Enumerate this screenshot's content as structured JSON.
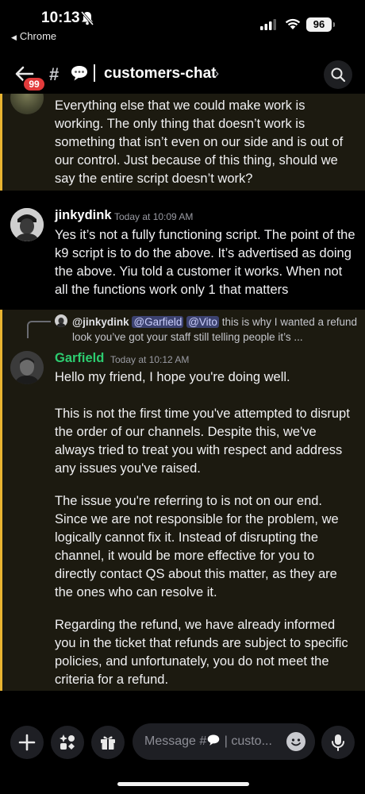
{
  "status_bar": {
    "time": "10:13",
    "back_app": "Chrome",
    "battery": "96"
  },
  "header": {
    "badge": "99",
    "hash": "#",
    "channel": "customers-chat",
    "chevron": "›"
  },
  "messages": [
    {
      "text": "Everything else that we could make work is working. The only thing that doesn’t work is something that isn’t even on our side and is out of our control. Just because of this thing, should we say the entire script doesn’t work?"
    },
    {
      "author": "jinkydink",
      "timestamp": "Today at 10:09 AM",
      "text": "Yes it’s not a fully functioning script. The point of the k9 script is to do the above. It’s advertised as doing the above. Yiu told a customer it works. When not all the functions work only 1 that matters"
    },
    {
      "reply": {
        "author": "@jinkydink",
        "mention1": "@Garfield",
        "mention2": "@Vito",
        "text": " this is why I wanted a refund look you’ve got your staff still telling people it’s ..."
      },
      "author": "Garfield",
      "timestamp": "Today at 10:12 AM",
      "paragraphs": [
        "Hello my friend, I hope you're doing well.",
        "This is not the first time you've attempted to disrupt the order of our channels. Despite this, we've always tried to treat you with respect and address any issues you've raised.",
        "The issue you're referring to is not on our end. Since we are not responsible for the problem, we logically cannot fix it. Instead of disrupting the channel, it would be more effective for you to directly contact QS about this matter, as they are the ones who can resolve it.",
        "Regarding the refund, we have already informed you in the ticket that refunds are subject to specific policies, and unfortunately, you do not meet the criteria for a refund."
      ]
    }
  ],
  "composer": {
    "placeholder_prefix": "Message #",
    "placeholder_suffix": "| custo..."
  },
  "colors": {
    "garfield_name": "#2dcc70",
    "highlight_bar": "#e9b431",
    "badge": "#e23b3b"
  }
}
